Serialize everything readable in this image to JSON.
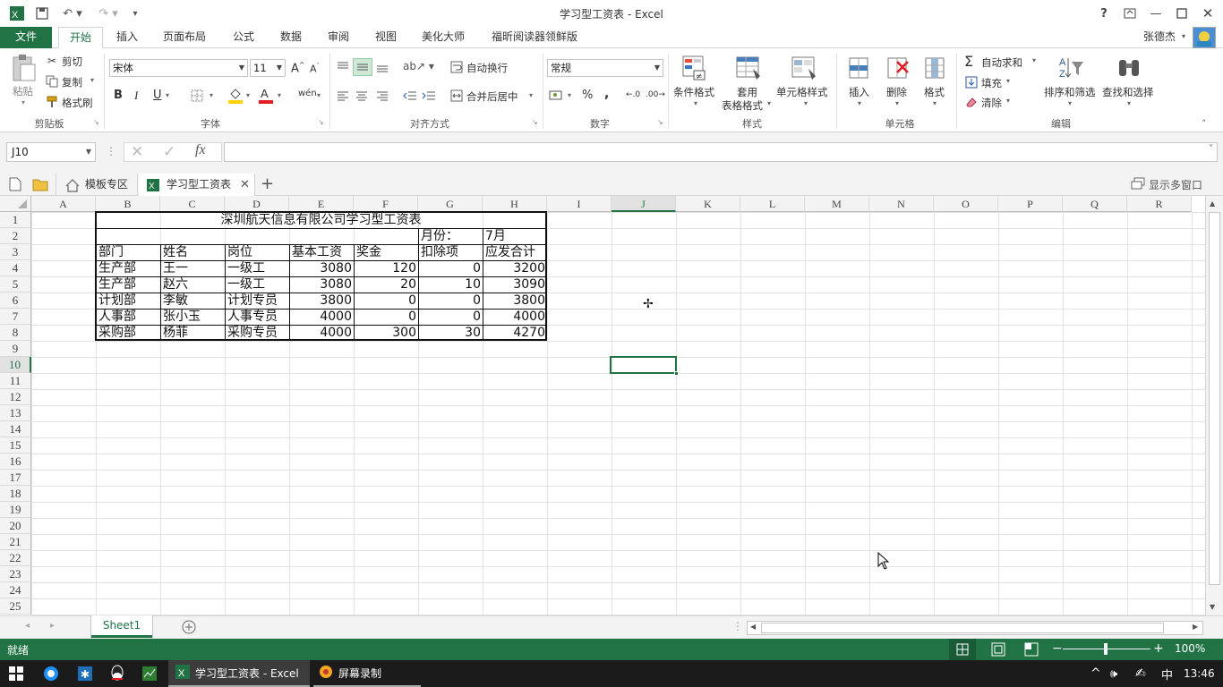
{
  "window": {
    "title": "学习型工资表 - Excel",
    "help": "?",
    "user": "张德杰"
  },
  "ribbon_tabs": [
    "文件",
    "开始",
    "插入",
    "页面布局",
    "公式",
    "数据",
    "审阅",
    "视图",
    "美化大师",
    "福昕阅读器领鲜版"
  ],
  "ribbon": {
    "clipboard": {
      "paste": "粘贴",
      "cut": "剪切",
      "copy": "复制",
      "format_painter": "格式刷",
      "label": "剪贴板"
    },
    "font": {
      "name": "宋体",
      "size": "11",
      "bold": "B",
      "italic": "I",
      "underline": "U",
      "label": "字体"
    },
    "alignment": {
      "wrap": "自动换行",
      "merge": "合并后居中",
      "label": "对齐方式"
    },
    "number": {
      "format": "常规",
      "percent": "%",
      "comma": ",",
      "label": "数字"
    },
    "styles": {
      "cond": "条件格式",
      "table1": "套用",
      "table2": "表格格式",
      "cell": "单元格样式",
      "label": "样式"
    },
    "cells": {
      "insert": "插入",
      "delete": "删除",
      "format": "格式",
      "label": "单元格"
    },
    "editing": {
      "autosum": "自动求和",
      "fill": "填充",
      "clear": "清除",
      "sort": "排序和筛选",
      "find": "查找和选择",
      "label": "编辑"
    }
  },
  "formula_bar": {
    "name_box": "J10",
    "fx": "fx",
    "content": ""
  },
  "workbook_tabs": {
    "template": "模板专区",
    "current": "学习型工资表",
    "multi_window": "显示多窗口"
  },
  "columns": [
    "A",
    "B",
    "C",
    "D",
    "E",
    "F",
    "G",
    "H",
    "I",
    "J",
    "K",
    "L",
    "M",
    "N",
    "O",
    "P",
    "Q",
    "R"
  ],
  "rows": [
    "1",
    "2",
    "3",
    "4",
    "5",
    "6",
    "7",
    "8",
    "9",
    "10",
    "11",
    "12",
    "13",
    "14",
    "15",
    "16",
    "17",
    "18",
    "19",
    "20",
    "21",
    "22",
    "23",
    "24",
    "25"
  ],
  "sheet": {
    "title": "深圳航天信息有限公司学习型工资表",
    "month_label": "月份：",
    "month_value": "7月",
    "headers": [
      "部门",
      "姓名",
      "岗位",
      "基本工资",
      "奖金",
      "扣除项",
      "应发合计"
    ],
    "data": [
      [
        "生产部",
        "王一",
        "一级工",
        "3080",
        "120",
        "0",
        "3200"
      ],
      [
        "生产部",
        "赵六",
        "一级工",
        "3080",
        "20",
        "10",
        "3090"
      ],
      [
        "计划部",
        "李敏",
        "计划专员",
        "3800",
        "0",
        "0",
        "3800"
      ],
      [
        "人事部",
        "张小玉",
        "人事专员",
        "4000",
        "0",
        "0",
        "4000"
      ],
      [
        "采购部",
        "杨菲",
        "采购专员",
        "4000",
        "300",
        "30",
        "4270"
      ]
    ]
  },
  "sheet_tabs": [
    "Sheet1"
  ],
  "status": {
    "ready": "就绪",
    "zoom": "100%"
  },
  "taskbar": {
    "excel": "学习型工资表 - Excel",
    "recorder": "屏幕录制",
    "ime": "中",
    "time": "13:46"
  },
  "colors": {
    "excel_green": "#217346",
    "grid": "#e2e2e2"
  }
}
